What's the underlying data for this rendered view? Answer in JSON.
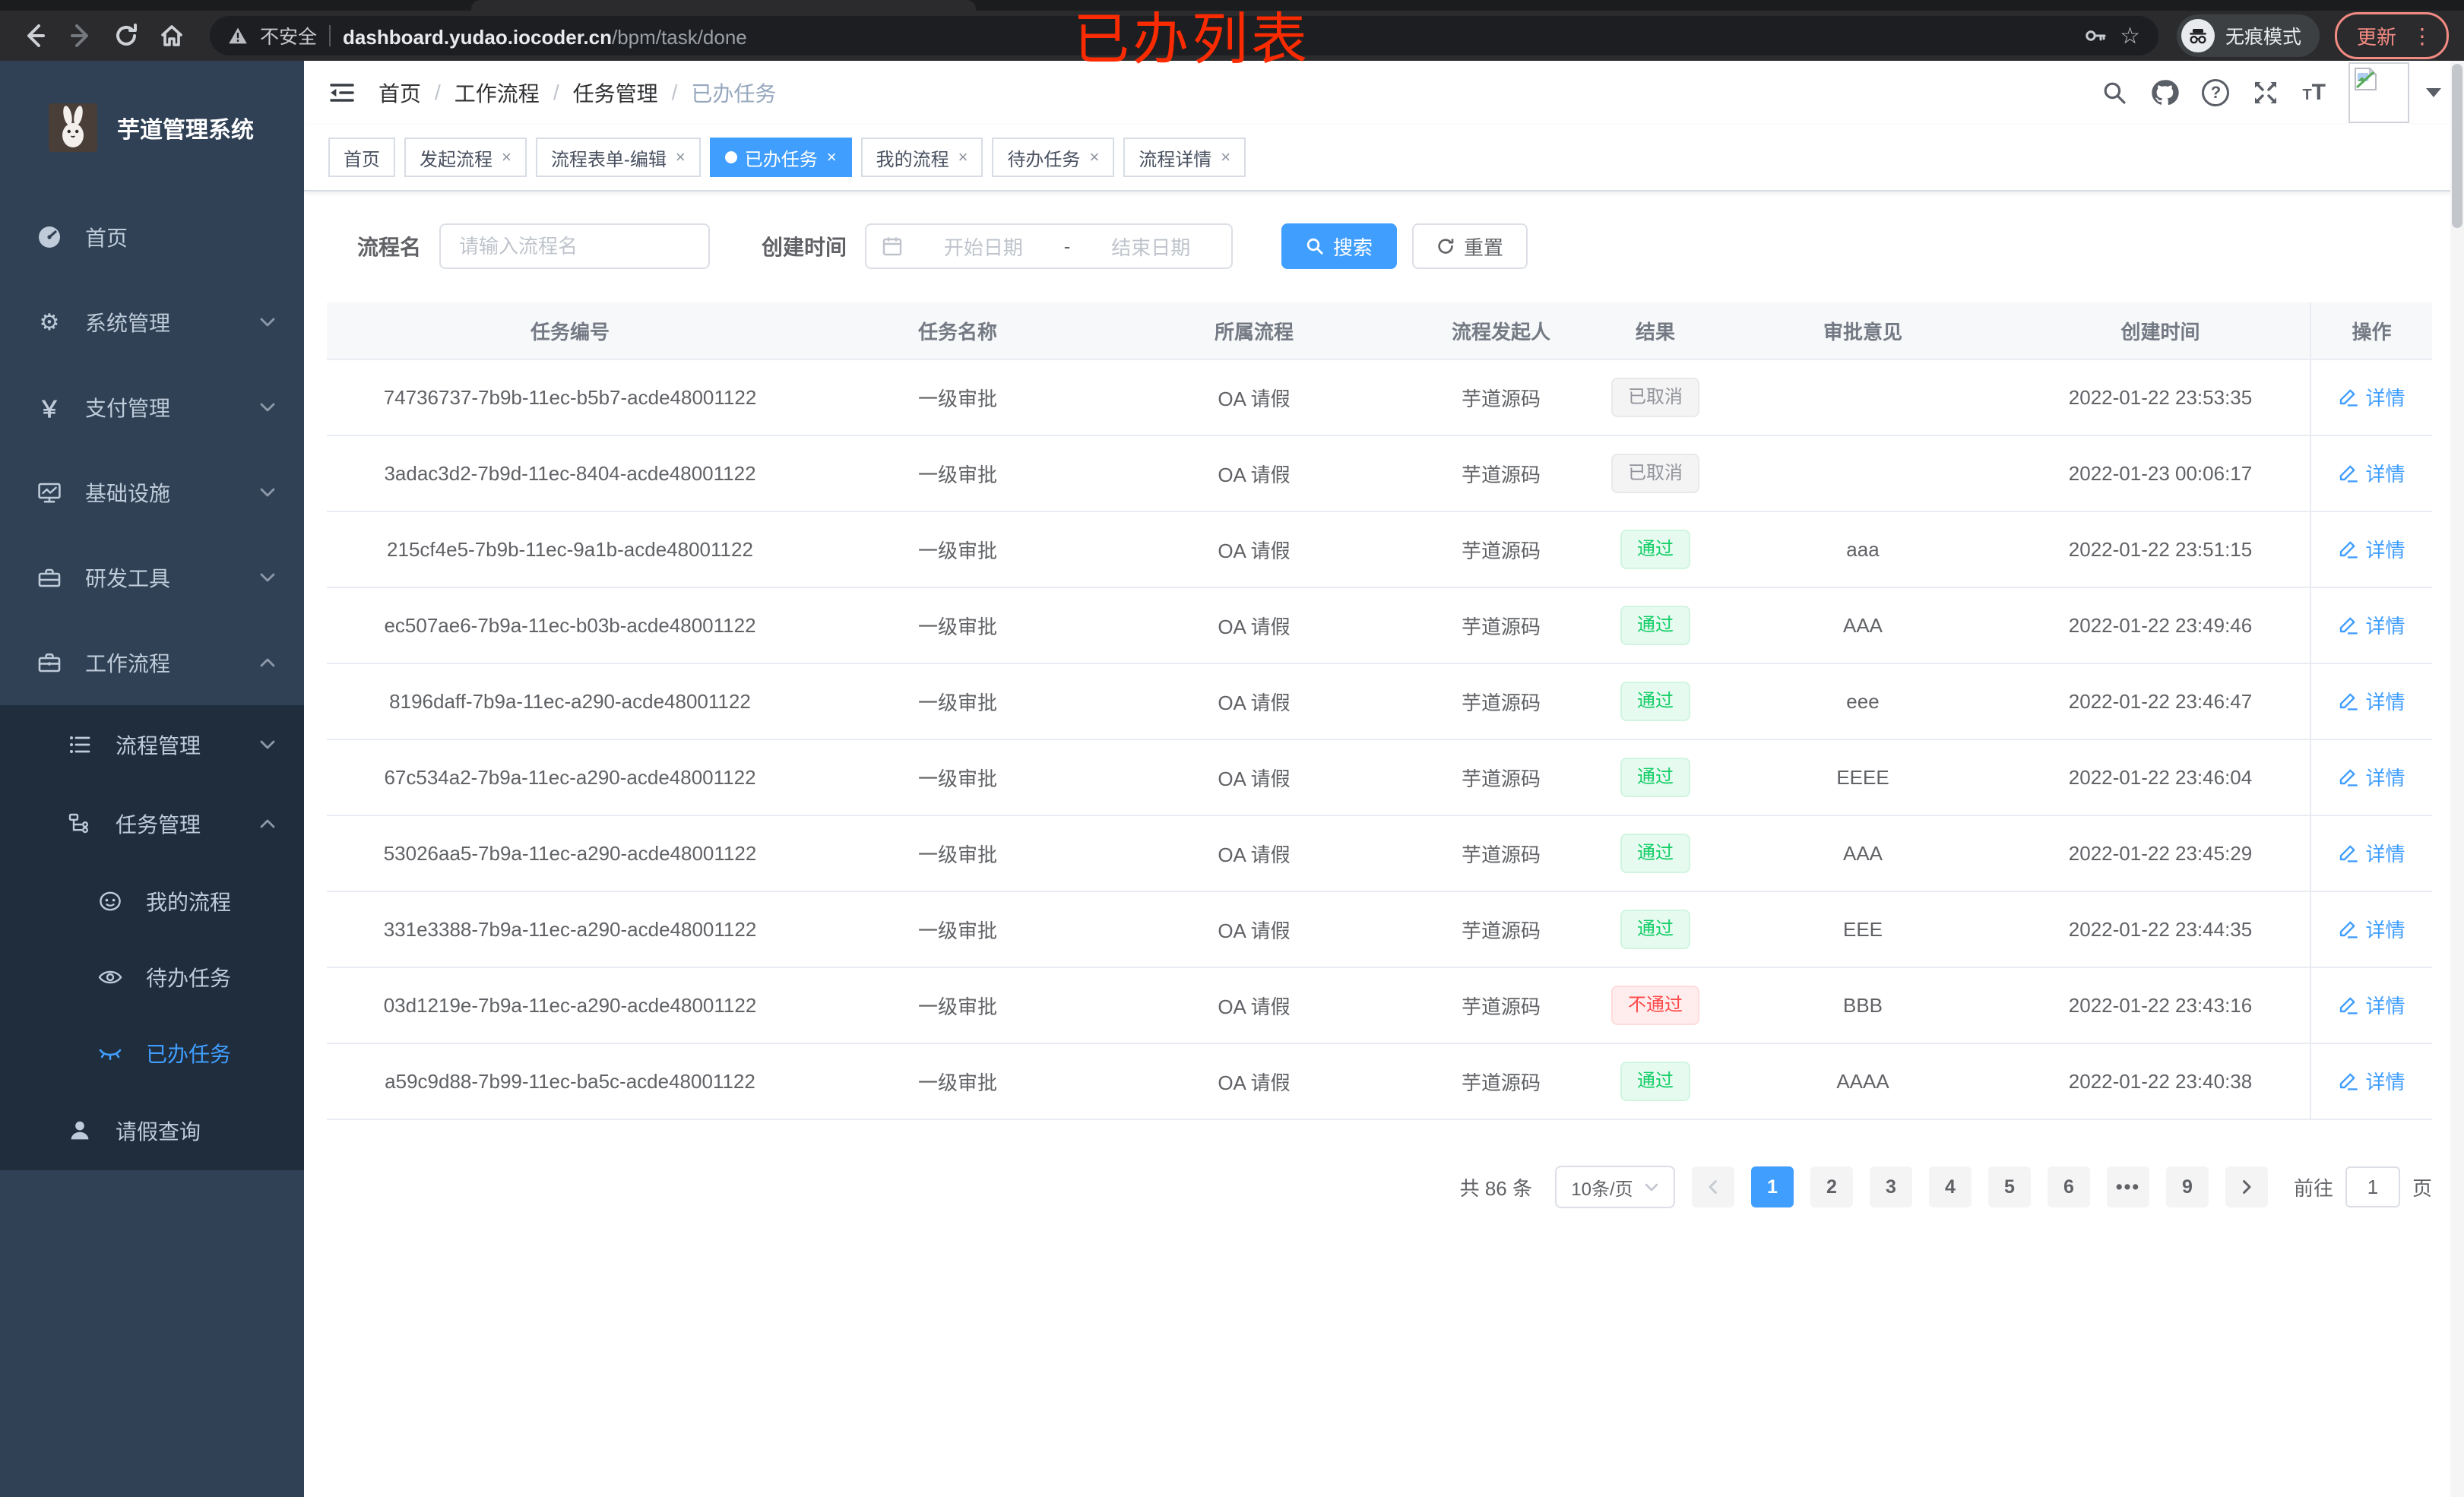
{
  "browser": {
    "security_label": "不安全",
    "url_host": "dashboard.yudao.iocoder.cn",
    "url_path": "/bpm/task/done",
    "incognito_label": "无痕模式",
    "update_label": "更新"
  },
  "annotation": {
    "text": "已办列表"
  },
  "colors": {
    "accent": "#409eff",
    "success": "#13ce66",
    "danger": "#ff4949",
    "info": "#909399",
    "sidebar_bg": "#304156",
    "submenu_bg": "#1f2d3d",
    "annotation_red": "#fb2b01"
  },
  "sidebar": {
    "app_title": "芋道管理系统",
    "menu": [
      {
        "label": "首页"
      },
      {
        "label": "系统管理"
      },
      {
        "label": "支付管理"
      },
      {
        "label": "基础设施"
      },
      {
        "label": "研发工具"
      },
      {
        "label": "工作流程"
      }
    ],
    "submenu": [
      {
        "label": "流程管理"
      },
      {
        "label": "任务管理"
      },
      {
        "label": "我的流程"
      },
      {
        "label": "待办任务"
      },
      {
        "label": "已办任务"
      },
      {
        "label": "请假查询"
      }
    ]
  },
  "breadcrumb": {
    "separator": "/",
    "items": [
      {
        "label": "首页"
      },
      {
        "label": "工作流程"
      },
      {
        "label": "任务管理"
      },
      {
        "label": "已办任务"
      }
    ]
  },
  "tabs": {
    "close_glyph": "×",
    "items": [
      {
        "label": "首页"
      },
      {
        "label": "发起流程"
      },
      {
        "label": "流程表单-编辑"
      },
      {
        "label": "已办任务"
      },
      {
        "label": "我的流程"
      },
      {
        "label": "待办任务"
      },
      {
        "label": "流程详情"
      }
    ]
  },
  "filter": {
    "name_label": "流程名",
    "name_placeholder": "请输入流程名",
    "time_label": "创建时间",
    "start_placeholder": "开始日期",
    "range_separator": "-",
    "end_placeholder": "结束日期",
    "search_label": "搜索",
    "reset_label": "重置"
  },
  "table": {
    "detail_label": "详情",
    "columns": [
      {
        "label": "任务编号"
      },
      {
        "label": "任务名称"
      },
      {
        "label": "所属流程"
      },
      {
        "label": "流程发起人"
      },
      {
        "label": "结果"
      },
      {
        "label": "审批意见"
      },
      {
        "label": "创建时间"
      },
      {
        "label": "操作"
      }
    ],
    "rows": [
      {
        "id": "74736737-7b9b-11ec-b5b7-acde48001122",
        "name": "一级审批",
        "process": "OA 请假",
        "starter": "芋道源码",
        "result": "已取消",
        "result_type": "info",
        "comment": "",
        "created": "2022-01-22 23:53:35"
      },
      {
        "id": "3adac3d2-7b9d-11ec-8404-acde48001122",
        "name": "一级审批",
        "process": "OA 请假",
        "starter": "芋道源码",
        "result": "已取消",
        "result_type": "info",
        "comment": "",
        "created": "2022-01-23 00:06:17"
      },
      {
        "id": "215cf4e5-7b9b-11ec-9a1b-acde48001122",
        "name": "一级审批",
        "process": "OA 请假",
        "starter": "芋道源码",
        "result": "通过",
        "result_type": "success",
        "comment": "aaa",
        "created": "2022-01-22 23:51:15"
      },
      {
        "id": "ec507ae6-7b9a-11ec-b03b-acde48001122",
        "name": "一级审批",
        "process": "OA 请假",
        "starter": "芋道源码",
        "result": "通过",
        "result_type": "success",
        "comment": "AAA",
        "created": "2022-01-22 23:49:46"
      },
      {
        "id": "8196daff-7b9a-11ec-a290-acde48001122",
        "name": "一级审批",
        "process": "OA 请假",
        "starter": "芋道源码",
        "result": "通过",
        "result_type": "success",
        "comment": "eee",
        "created": "2022-01-22 23:46:47"
      },
      {
        "id": "67c534a2-7b9a-11ec-a290-acde48001122",
        "name": "一级审批",
        "process": "OA 请假",
        "starter": "芋道源码",
        "result": "通过",
        "result_type": "success",
        "comment": "EEEE",
        "created": "2022-01-22 23:46:04"
      },
      {
        "id": "53026aa5-7b9a-11ec-a290-acde48001122",
        "name": "一级审批",
        "process": "OA 请假",
        "starter": "芋道源码",
        "result": "通过",
        "result_type": "success",
        "comment": "AAA",
        "created": "2022-01-22 23:45:29"
      },
      {
        "id": "331e3388-7b9a-11ec-a290-acde48001122",
        "name": "一级审批",
        "process": "OA 请假",
        "starter": "芋道源码",
        "result": "通过",
        "result_type": "success",
        "comment": "EEE",
        "created": "2022-01-22 23:44:35"
      },
      {
        "id": "03d1219e-7b9a-11ec-a290-acde48001122",
        "name": "一级审批",
        "process": "OA 请假",
        "starter": "芋道源码",
        "result": "不通过",
        "result_type": "danger",
        "comment": "BBB",
        "created": "2022-01-22 23:43:16"
      },
      {
        "id": "a59c9d88-7b99-11ec-ba5c-acde48001122",
        "name": "一级审批",
        "process": "OA 请假",
        "starter": "芋道源码",
        "result": "通过",
        "result_type": "success",
        "comment": "AAAA",
        "created": "2022-01-22 23:40:38"
      }
    ]
  },
  "pagination": {
    "total_text": "共 86 条",
    "page_size": "10条/页",
    "pages": [
      {
        "label": "1"
      },
      {
        "label": "2"
      },
      {
        "label": "3"
      },
      {
        "label": "4"
      },
      {
        "label": "5"
      },
      {
        "label": "6"
      },
      {
        "label": "•••"
      },
      {
        "label": "9"
      }
    ],
    "goto_label": "前往",
    "goto_value": "1",
    "page_unit": "页"
  }
}
